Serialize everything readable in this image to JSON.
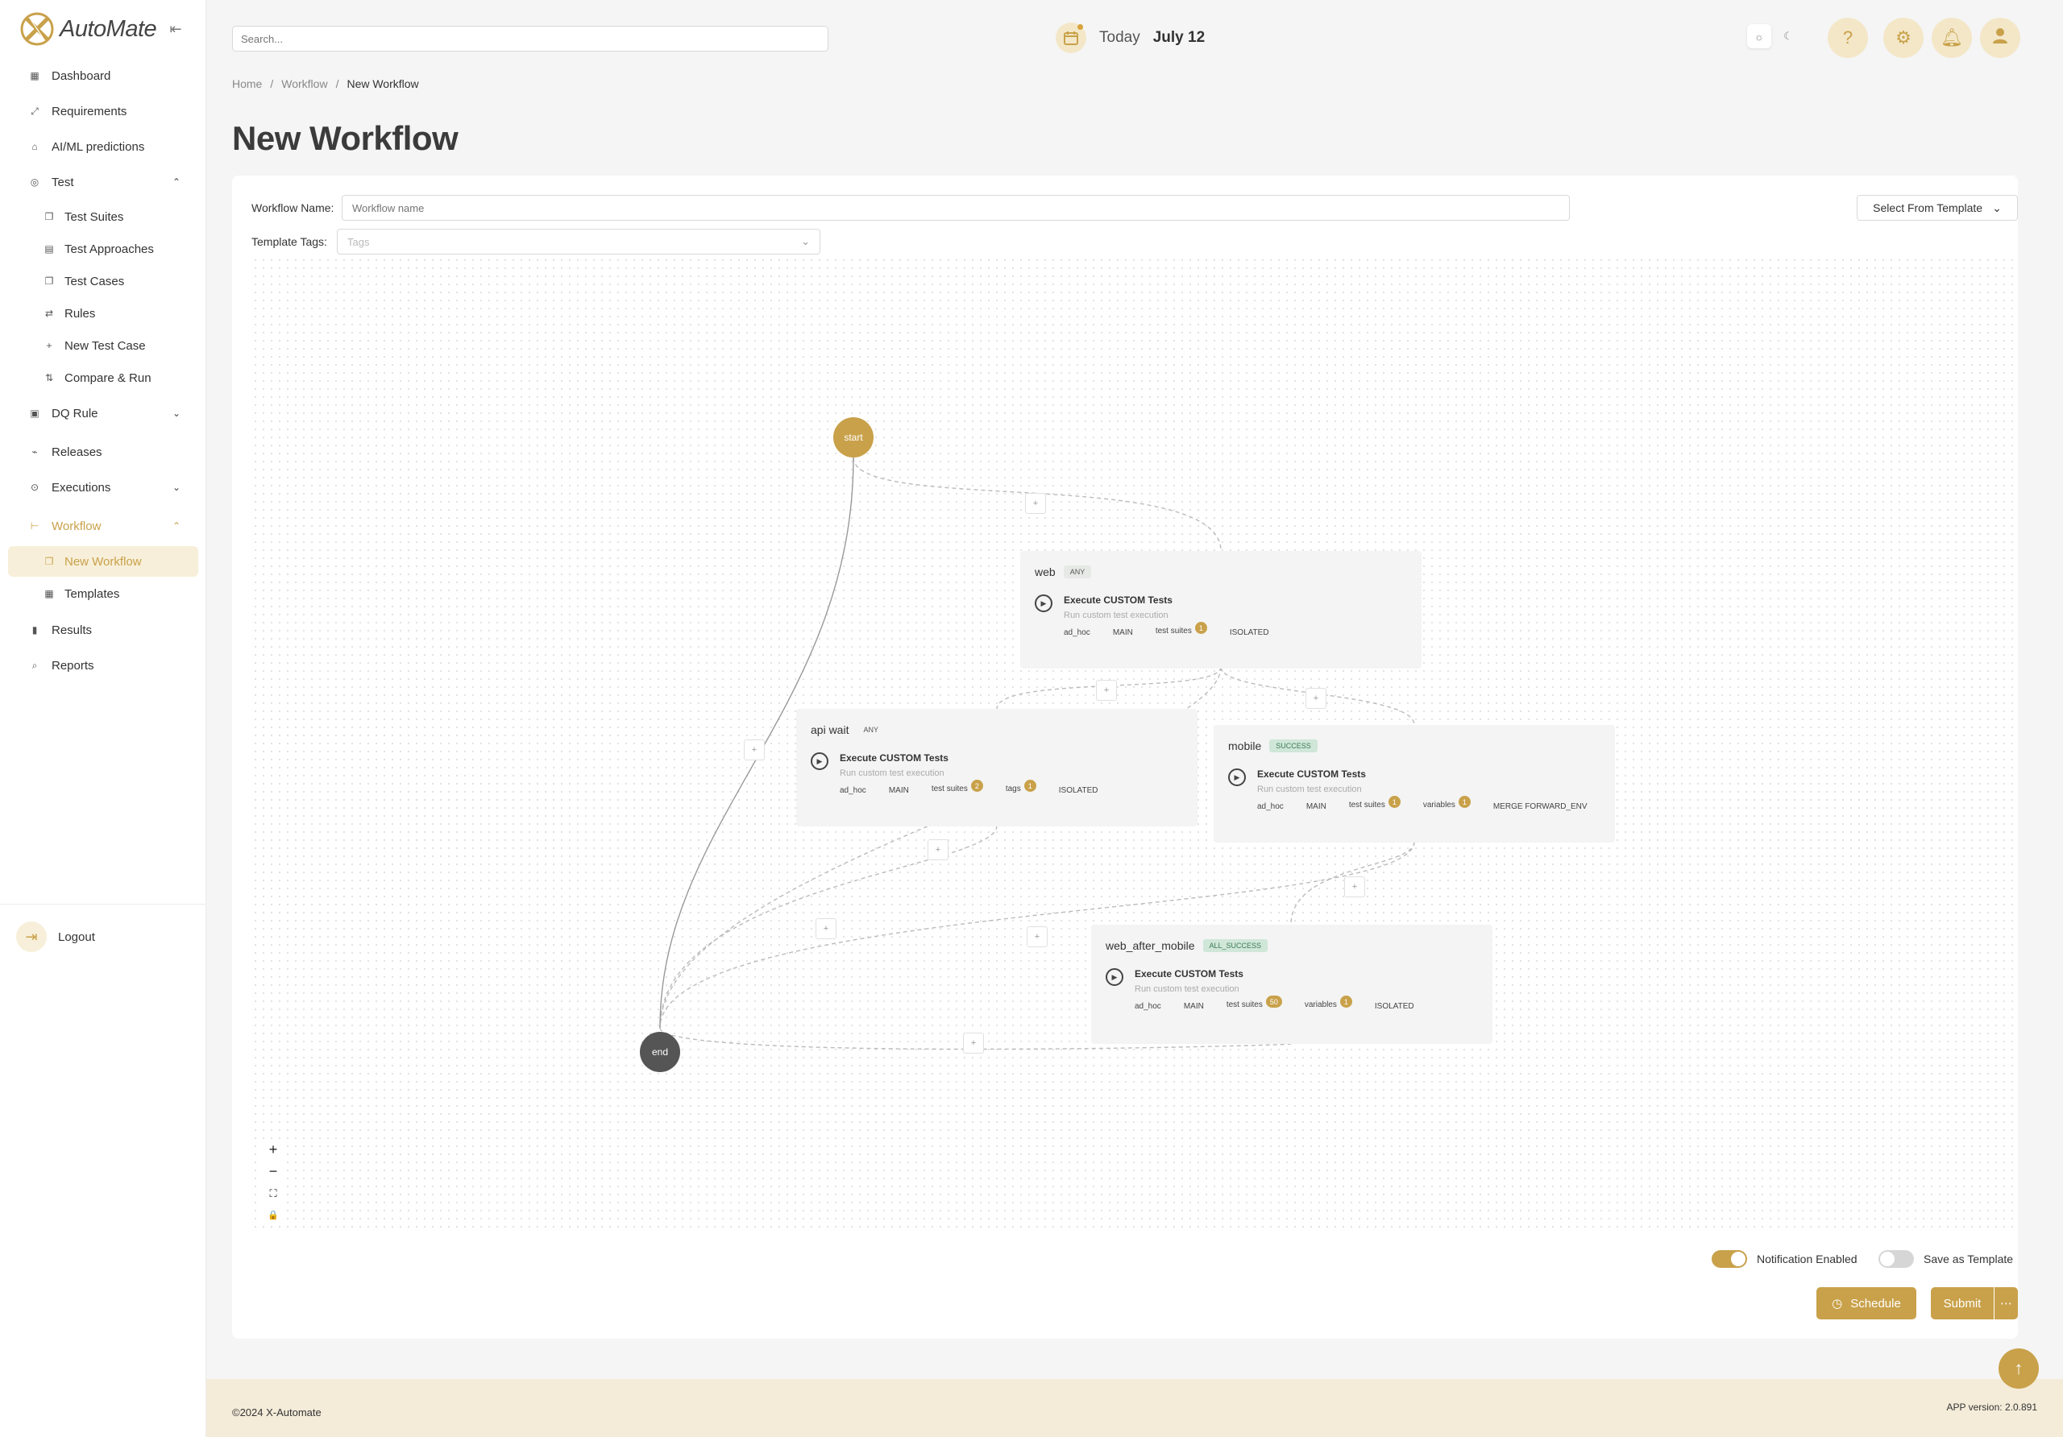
{
  "app": {
    "name": "AutoMate"
  },
  "sidebar": {
    "items": {
      "dashboard": "Dashboard",
      "requirements": "Requirements",
      "aiml": "AI/ML predictions",
      "test": "Test",
      "test_suites": "Test Suites",
      "test_approaches": "Test Approaches",
      "test_cases": "Test Cases",
      "rules": "Rules",
      "new_test_case": "New Test Case",
      "compare_run": "Compare & Run",
      "dq_rule": "DQ Rule",
      "releases": "Releases",
      "executions": "Executions",
      "workflow": "Workflow",
      "new_workflow": "New Workflow",
      "templates": "Templates",
      "results": "Results",
      "reports": "Reports"
    },
    "logout": "Logout"
  },
  "header": {
    "search_placeholder": "Search...",
    "today_label": "Today",
    "date": "July 12"
  },
  "breadcrumb": {
    "home": "Home",
    "workflow": "Workflow",
    "current": "New Workflow"
  },
  "page": {
    "title": "New Workflow"
  },
  "form": {
    "name_label": "Workflow Name:",
    "name_placeholder": "Workflow name",
    "tags_label": "Template Tags:",
    "tags_placeholder": "Tags",
    "template_select": "Select From Template"
  },
  "graph": {
    "start": "start",
    "end": "end",
    "plus": "+",
    "nodes": [
      {
        "name": "web",
        "trigger": "ANY",
        "task_title": "Execute CUSTOM Tests",
        "task_desc": "Run custom test execution",
        "chips": {
          "c1": "ad_hoc",
          "c2": "MAIN",
          "suites": "test suites",
          "suites_count": "1",
          "mode": "ISOLATED"
        }
      },
      {
        "name": "api wait",
        "trigger": "ANY",
        "task_title": "Execute CUSTOM Tests",
        "task_desc": "Run custom test execution",
        "chips": {
          "c1": "ad_hoc",
          "c2": "MAIN",
          "suites": "test suites",
          "suites_count": "2",
          "tags": "tags",
          "tags_count": "1",
          "mode": "ISOLATED"
        }
      },
      {
        "name": "mobile",
        "trigger": "SUCCESS",
        "task_title": "Execute CUSTOM Tests",
        "task_desc": "Run custom test execution",
        "chips": {
          "c1": "ad_hoc",
          "c2": "MAIN",
          "suites": "test suites",
          "suites_count": "1",
          "vars": "variables",
          "vars_count": "1",
          "mode": "MERGE FORWARD_ENV"
        }
      },
      {
        "name": "web_after_mobile",
        "trigger": "ALL_SUCCESS",
        "task_title": "Execute CUSTOM Tests",
        "task_desc": "Run custom test execution",
        "chips": {
          "c1": "ad_hoc",
          "c2": "MAIN",
          "suites": "test suites",
          "suites_count": "50",
          "vars": "variables",
          "vars_count": "1",
          "mode": "ISOLATED"
        }
      }
    ]
  },
  "zoom": {
    "in": "+",
    "out": "−",
    "fit": "⛶",
    "lock": "🔒"
  },
  "options": {
    "notification": "Notification Enabled",
    "notification_on": true,
    "save_template": "Save as Template",
    "save_template_on": false
  },
  "actions": {
    "schedule": "Schedule",
    "submit": "Submit",
    "more": "⋯"
  },
  "footer": {
    "copyright": "©2024 X-Automate",
    "version": "APP version: 2.0.891"
  },
  "colors": {
    "accent": "#c9a14a",
    "accent_light": "#f3e7c8",
    "end_node": "#555555"
  }
}
